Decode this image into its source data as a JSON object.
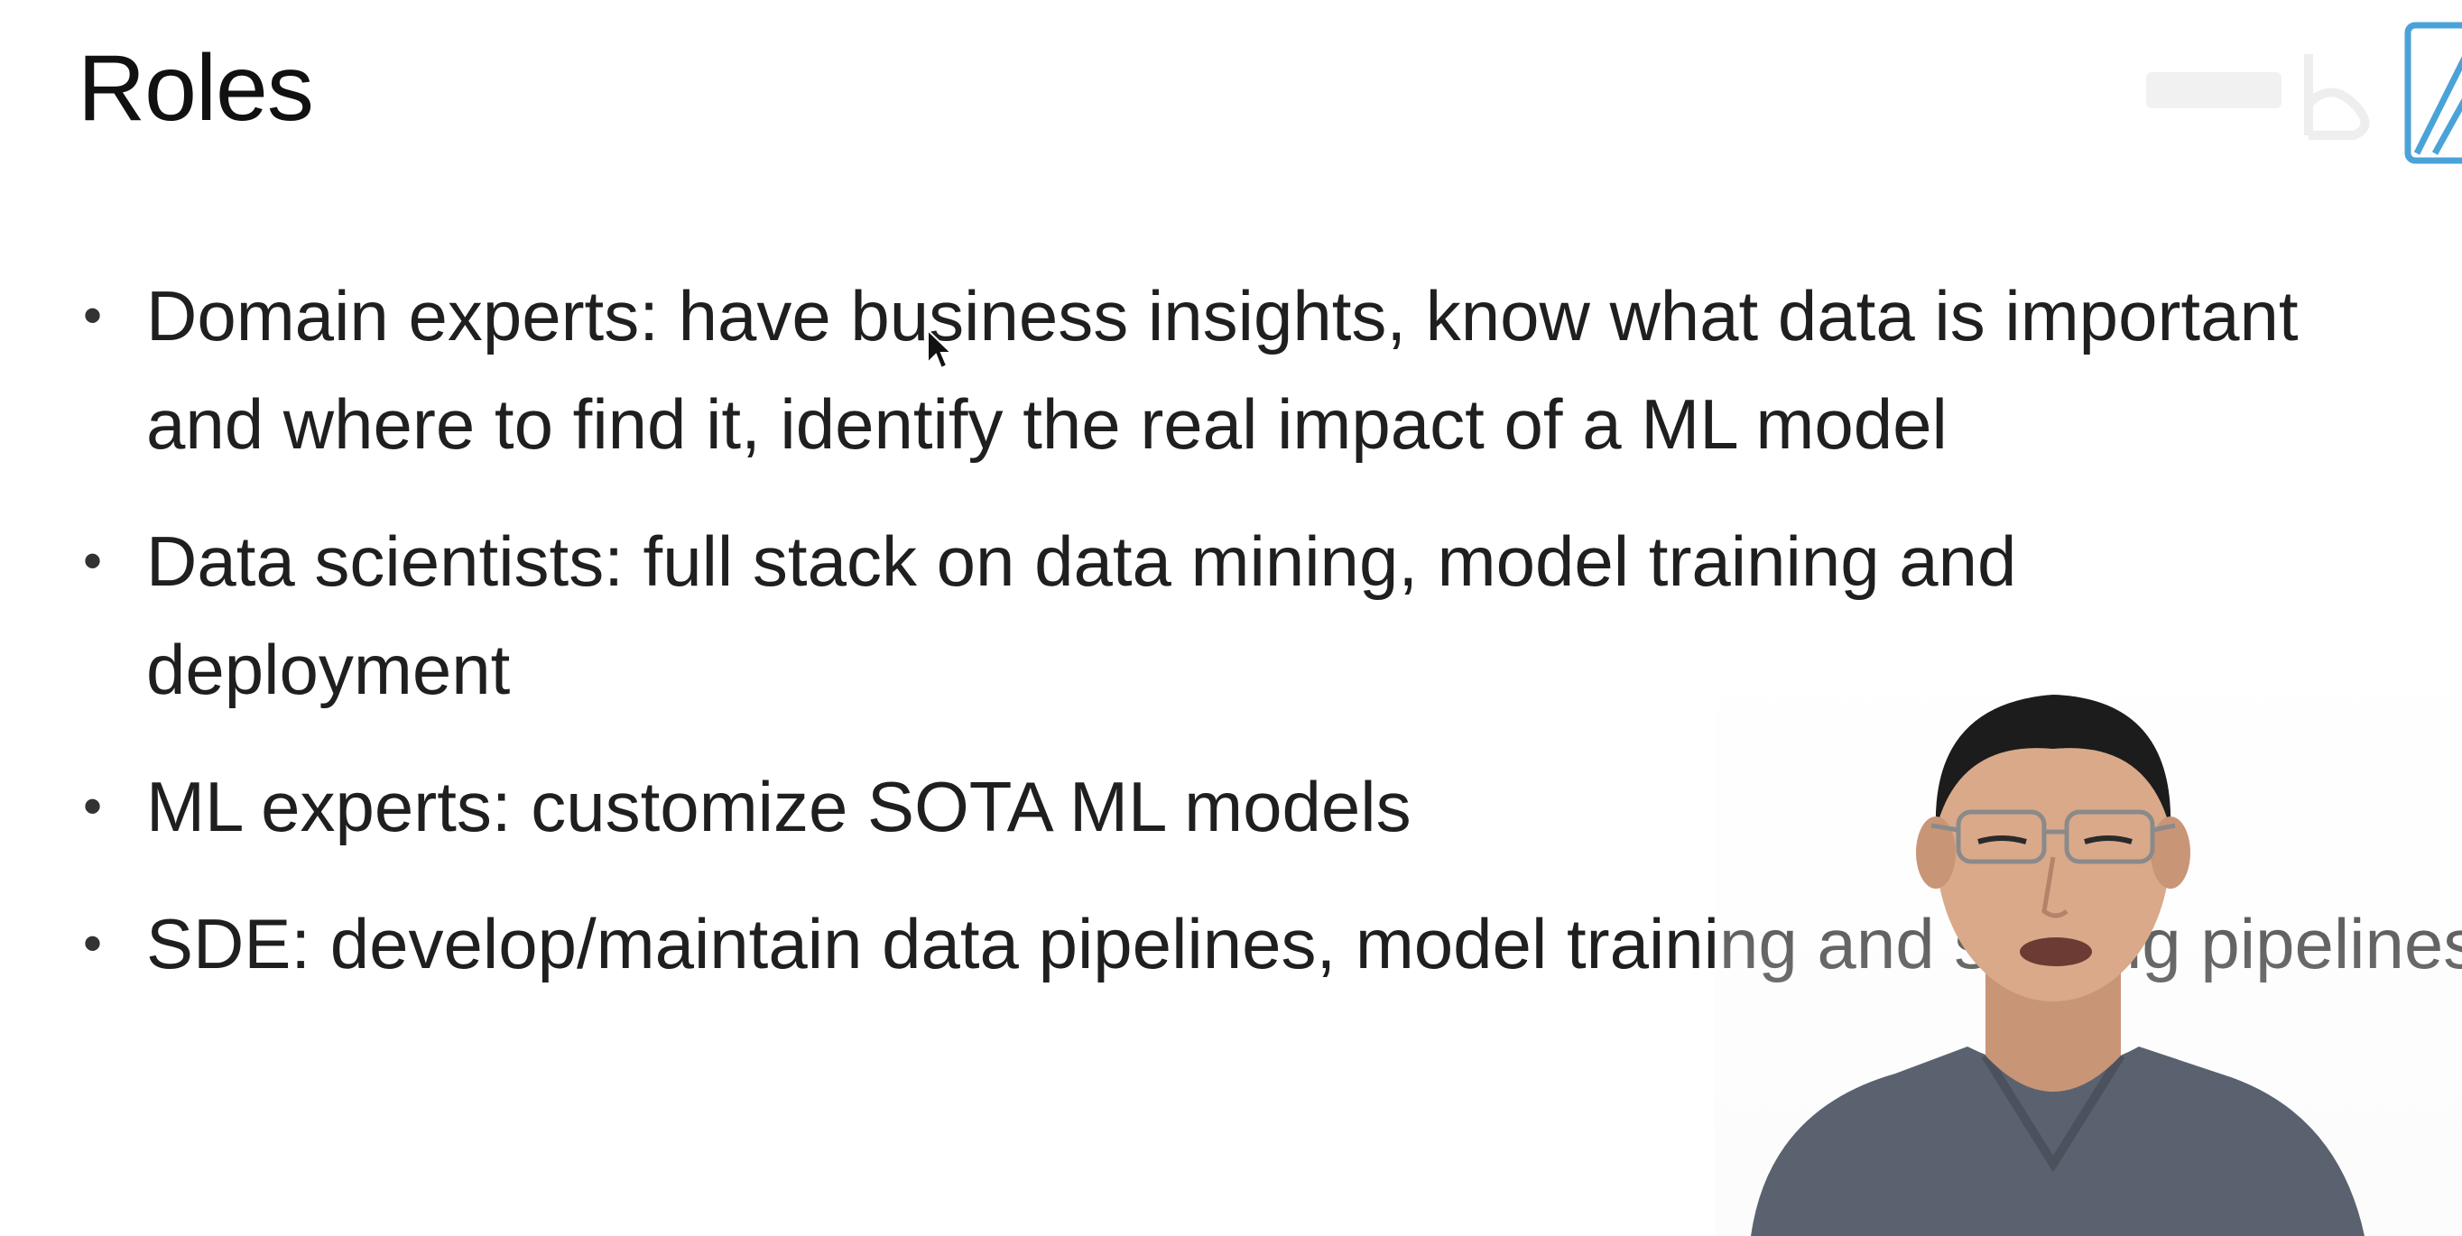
{
  "slide": {
    "title": "Roles",
    "bullets": [
      "Domain experts: have business insights, know what data is important and where to find it, identify the real impact of a ML model",
      "Data scientists: full stack on data mining, model training and deployment",
      "ML experts: customize SOTA ML models",
      "SDE: develop/maintain data pipelines, model training and serving pipelines"
    ],
    "bullet_glyph": "•"
  },
  "overlays": {
    "watermark_icon": "bilibili-logo-icon",
    "presenter": "presenter-webcam",
    "cursor": "mouse-cursor-icon"
  },
  "colors": {
    "background": "#ffffff",
    "text": "#1f1f1f",
    "watermark_accent": "#4aa3d8",
    "presenter_shirt": "#5a6270",
    "presenter_skin": "#d9a98a",
    "presenter_hair": "#1c1c1c"
  }
}
